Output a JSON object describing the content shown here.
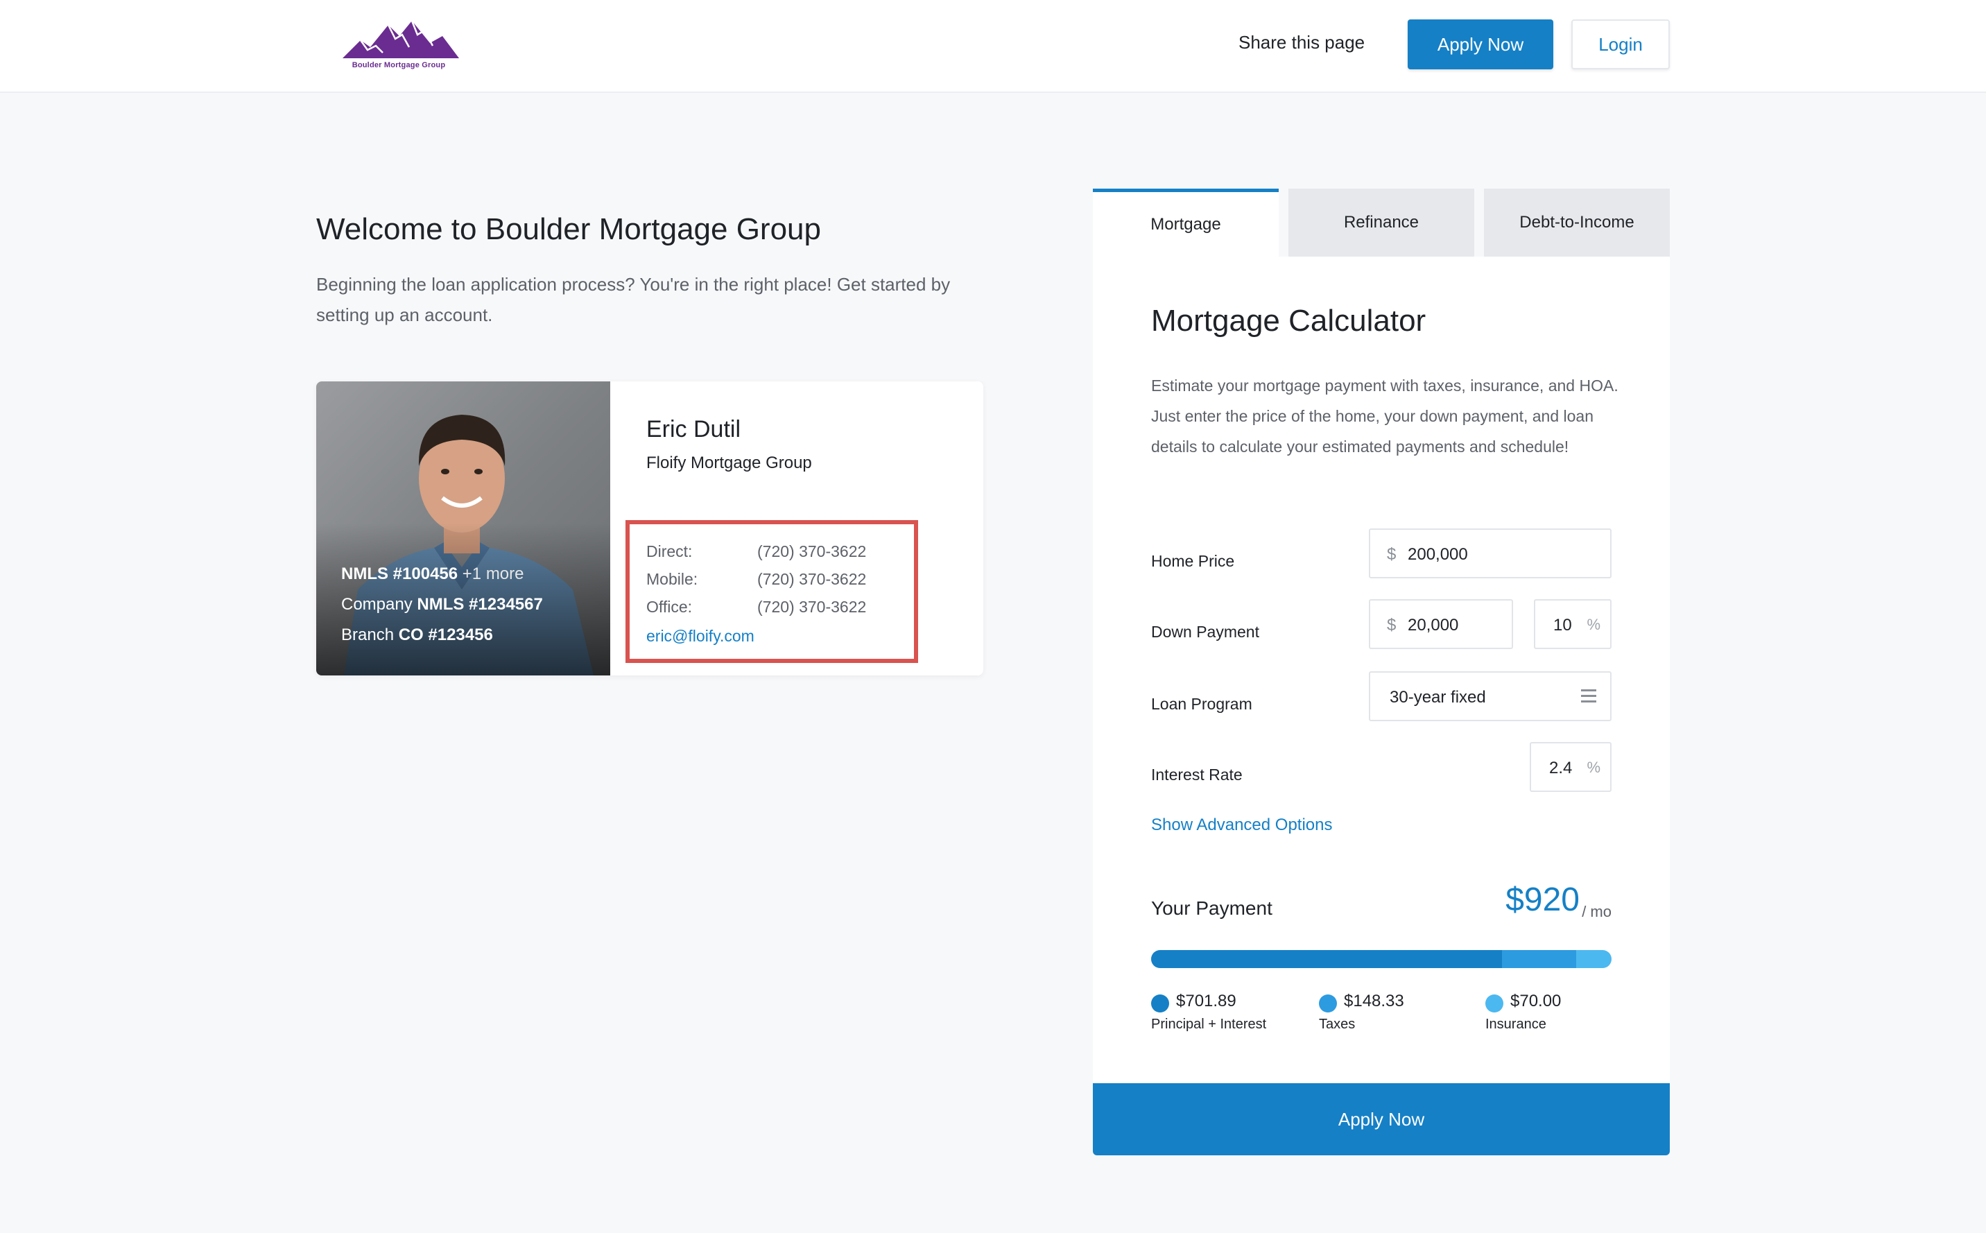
{
  "header": {
    "logo_text": "Boulder Mortgage Group",
    "share_label": "Share this page",
    "apply_label": "Apply Now",
    "login_label": "Login"
  },
  "welcome": {
    "title": "Welcome to Boulder Mortgage Group",
    "text": "Beginning the loan application process? You're in the right place! Get started by setting up an account."
  },
  "loan_officer": {
    "name": "Eric Dutil",
    "company": "Floify Mortgage Group",
    "nmls_label": "NMLS",
    "nmls_value": "#100456",
    "nmls_more": "+1 more",
    "company_nmls_prefix": "Company",
    "company_nmls_value": "NMLS #1234567",
    "branch_prefix": "Branch",
    "branch_value": "CO #123456",
    "contacts": [
      {
        "label": "Direct:",
        "value": "(720) 370-3622"
      },
      {
        "label": "Mobile:",
        "value": "(720) 370-3622"
      },
      {
        "label": "Office:",
        "value": "(720) 370-3622"
      }
    ],
    "email": "eric@floify.com"
  },
  "calculator": {
    "tabs": [
      {
        "label": "Mortgage",
        "active": true
      },
      {
        "label": "Refinance",
        "active": false
      },
      {
        "label": "Debt-to-Income",
        "active": false
      }
    ],
    "title": "Mortgage Calculator",
    "description": "Estimate your mortgage payment with taxes, insurance, and HOA. Just enter the price of the home, your down payment, and loan details to calculate your estimated payments and schedule!",
    "currency_symbol": "$",
    "percent_symbol": "%",
    "fields": {
      "home_price": {
        "label": "Home Price",
        "value": "200,000"
      },
      "down_payment": {
        "label": "Down Payment",
        "value": "20,000",
        "percent": "10"
      },
      "loan_program": {
        "label": "Loan Program",
        "value": "30-year fixed"
      },
      "interest_rate": {
        "label": "Interest Rate",
        "value": "2.4"
      }
    },
    "advanced_link": "Show Advanced Options",
    "payment": {
      "label": "Your Payment",
      "amount": "$920",
      "unit": "/ mo",
      "breakdown": [
        {
          "amount": "$701.89",
          "label": "Principal + Interest",
          "value": 701.89,
          "color": "#1580c6"
        },
        {
          "amount": "$148.33",
          "label": "Taxes",
          "value": 148.33,
          "color": "#2d9be0"
        },
        {
          "amount": "$70.00",
          "label": "Insurance",
          "value": 70.0,
          "color": "#4cb8f0"
        }
      ]
    },
    "apply_label": "Apply Now"
  },
  "colors": {
    "primary": "#1580c6",
    "highlight_border": "#d9534f",
    "logo_purple": "#6a2c91"
  }
}
